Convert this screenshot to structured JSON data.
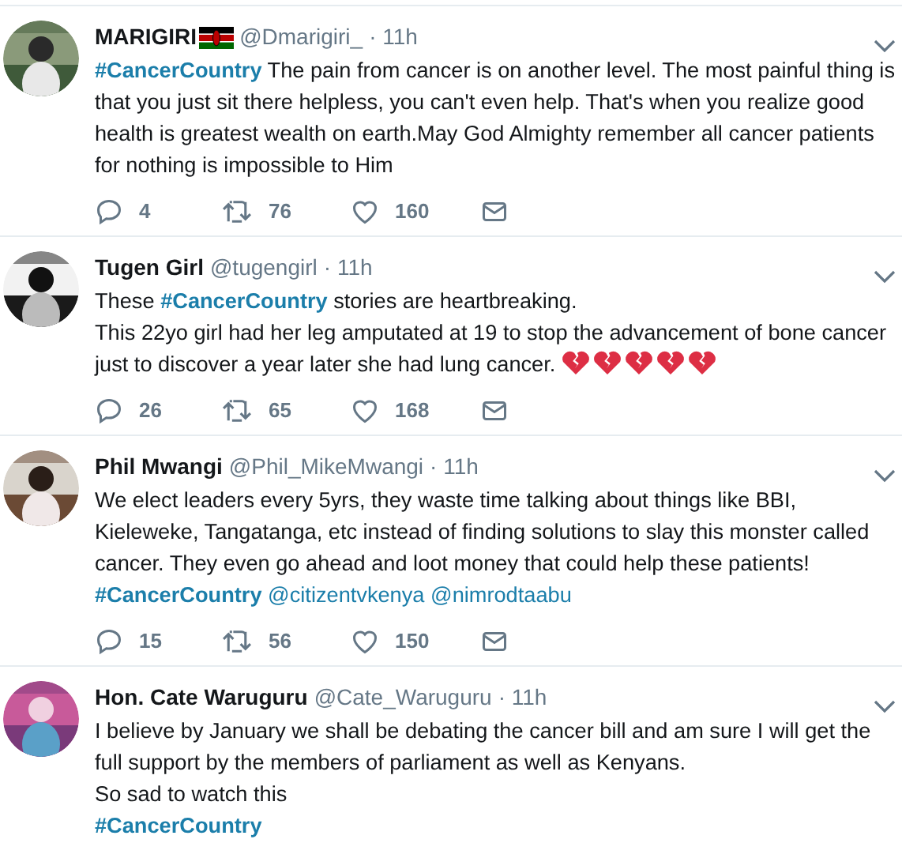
{
  "tweets": [
    {
      "name": "MARIGIRI",
      "badge": {
        "kind": "flag"
      },
      "handle": "@Dmarigiri_",
      "time": "· 11h",
      "body": [
        {
          "kind": "hashtag",
          "text": "#CancerCountry"
        },
        {
          "kind": "text",
          "text": " The pain from cancer is on another level. The most painful thing is that you just sit there helpless, you can't even help. That's when you realize good health is greatest wealth on earth.May God Almighty remember all cancer patients for nothing is impossible to Him"
        }
      ],
      "replies": "4",
      "retweets": "76",
      "likes": "160"
    },
    {
      "name": "Tugen Girl",
      "handle": "@tugengirl",
      "time": "· 11h",
      "body": [
        {
          "kind": "text",
          "text": "These "
        },
        {
          "kind": "hashtag",
          "text": "#CancerCountry"
        },
        {
          "kind": "text",
          "text": " stories are heartbreaking."
        },
        {
          "kind": "break"
        },
        {
          "kind": "text",
          "text": "This 22yo girl had her leg amputated at 19 to stop the advancement of bone cancer just to discover a year later she had lung cancer. "
        },
        {
          "kind": "broken-heart"
        },
        {
          "kind": "broken-heart"
        },
        {
          "kind": "broken-heart"
        },
        {
          "kind": "broken-heart"
        },
        {
          "kind": "broken-heart"
        }
      ],
      "replies": "26",
      "retweets": "65",
      "likes": "168"
    },
    {
      "name": "Phil Mwangi",
      "handle": "@Phil_MikeMwangi",
      "time": "· 11h",
      "body": [
        {
          "kind": "text",
          "text": "We elect leaders every 5yrs, they waste time talking about things like BBI, Kieleweke, Tangatanga, etc instead of finding solutions to slay this monster called cancer. They even go ahead and loot money that could help these patients!"
        },
        {
          "kind": "break"
        },
        {
          "kind": "hashtag",
          "text": "#CancerCountry"
        },
        {
          "kind": "space"
        },
        {
          "kind": "mention",
          "text": "@citizentvkenya"
        },
        {
          "kind": "space"
        },
        {
          "kind": "mention",
          "text": "@nimrodtaabu"
        }
      ],
      "replies": "15",
      "retweets": "56",
      "likes": "150"
    },
    {
      "name": "Hon. Cate Waruguru",
      "handle": "@Cate_Waruguru",
      "time": "· 11h",
      "body": [
        {
          "kind": "text",
          "text": "I believe by January we shall be debating the cancer bill and am sure I will get the full support by the members of parliament as well as Kenyans."
        },
        {
          "kind": "break"
        },
        {
          "kind": "text",
          "text": "So sad to watch this"
        },
        {
          "kind": "break"
        },
        {
          "kind": "hashtag",
          "text": "#CancerCountry"
        }
      ]
    }
  ]
}
